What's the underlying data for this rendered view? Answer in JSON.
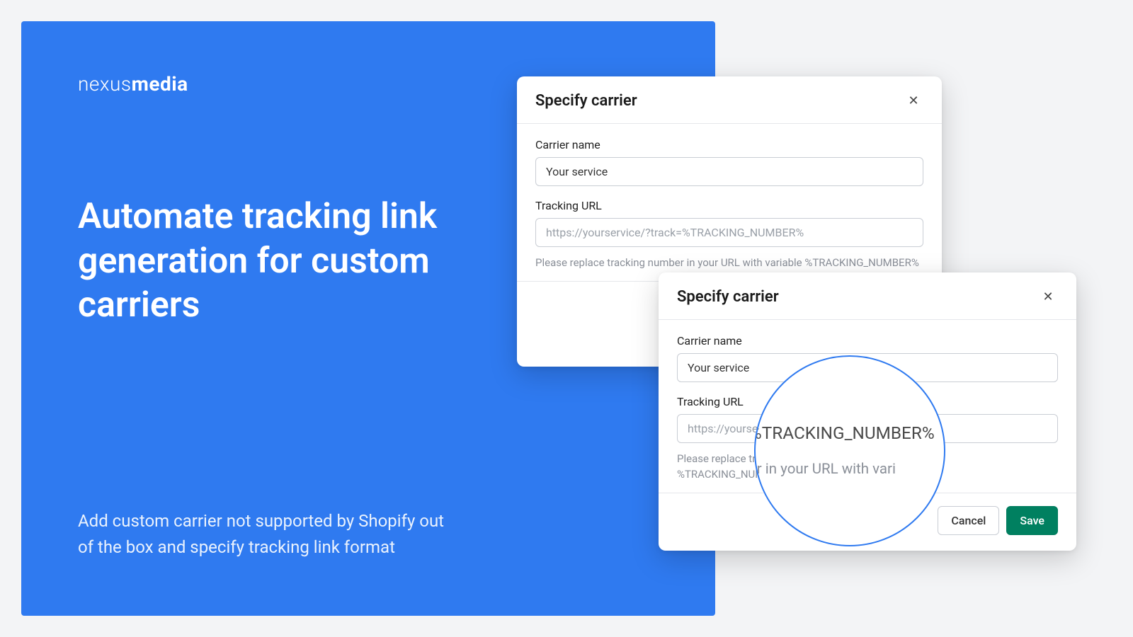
{
  "brand": {
    "light": "nexus",
    "bold": "media"
  },
  "headline": "Automate tracking link generation for custom carriers",
  "subtext": "Add custom carrier not supported by Shopify out of the box and specify tracking link format",
  "modal": {
    "title": "Specify carrier",
    "carrier_label": "Carrier name",
    "carrier_value": "Your service",
    "url_label": "Tracking URL",
    "url_placeholder": "https://yourservice/?track=%TRACKING_NUMBER%",
    "hint": "Please replace tracking number in your URL with variable %TRACKING_NUMBER%",
    "cancel": "Cancel",
    "save": "Save"
  },
  "magnifier": {
    "big": "%TRACKING_NUMBER%",
    "small_a": "er in your URL with vari"
  },
  "partial": {
    "url_cut": "https://yourservice/?trac",
    "hint_cut": "Please replace tracking num"
  }
}
